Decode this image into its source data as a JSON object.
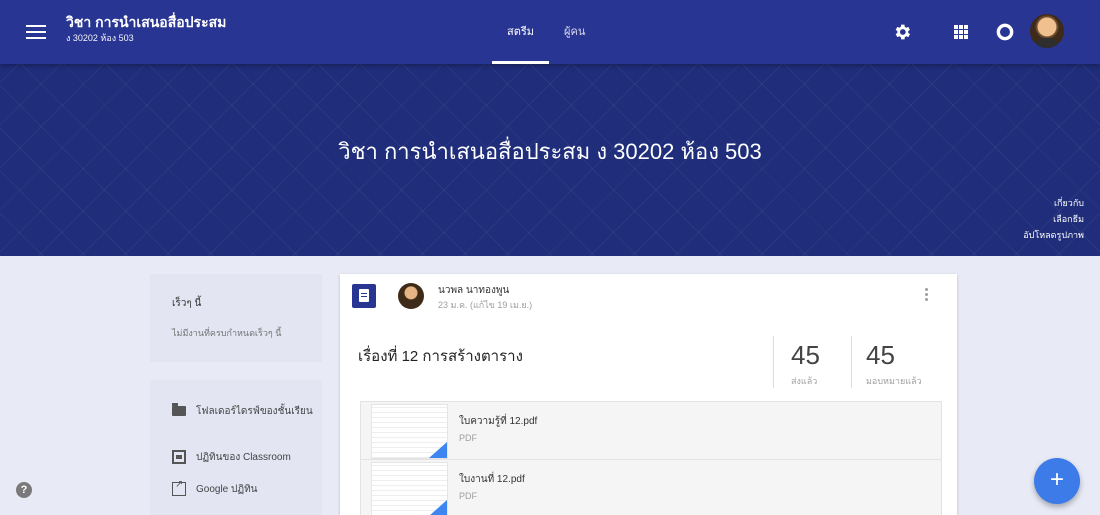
{
  "header": {
    "class_title": "วิชา การนำเสนอสื่อประสม",
    "class_subtitle": "ง 30202 ห้อง 503",
    "tabs": [
      {
        "label": "สตรีม",
        "active": true
      },
      {
        "label": "ผู้คน",
        "active": false
      }
    ],
    "icons": [
      "menu-icon",
      "gear-icon",
      "apps-icon",
      "notification-icon",
      "avatar"
    ],
    "color": "#283593"
  },
  "banner": {
    "title": "วิชา การนำเสนอสื่อประสม ง 30202 ห้อง 503",
    "links": [
      "เกี่ยวกับ",
      "เลือกธีม",
      "อัปโหลดรูปภาพ"
    ]
  },
  "sidebar": {
    "recent_title": "เร็วๆ นี้",
    "recent_text": "ไม่มีงานที่ครบกำหนดเร็วๆ นี้",
    "links": [
      {
        "label": "โฟลเดอร์ไดรฟ์ของชั้นเรียน",
        "icon": "folder-icon"
      },
      {
        "label": "ปฏิทินของ Classroom",
        "icon": "calendar-icon"
      },
      {
        "label": "Google ปฏิทิน",
        "icon": "external-link-icon"
      }
    ]
  },
  "post": {
    "author": "นวพล นาทองพูน",
    "date": "23 ม.ค. (แก้ไข 19 เม.ย.)",
    "title": "เรื่องที่ 12 การสร้างตาราง",
    "stats": [
      {
        "value": "45",
        "label": "ส่งแล้ว"
      },
      {
        "value": "45",
        "label": "มอบหมายแล้ว"
      }
    ],
    "attachments": [
      {
        "name": "ใบความรู้ที่ 12.pdf",
        "type": "PDF"
      },
      {
        "name": "ใบงานที่ 12.pdf",
        "type": "PDF"
      }
    ]
  },
  "fab_label": "+",
  "help_label": "?",
  "accent_color": "#3d7be8"
}
